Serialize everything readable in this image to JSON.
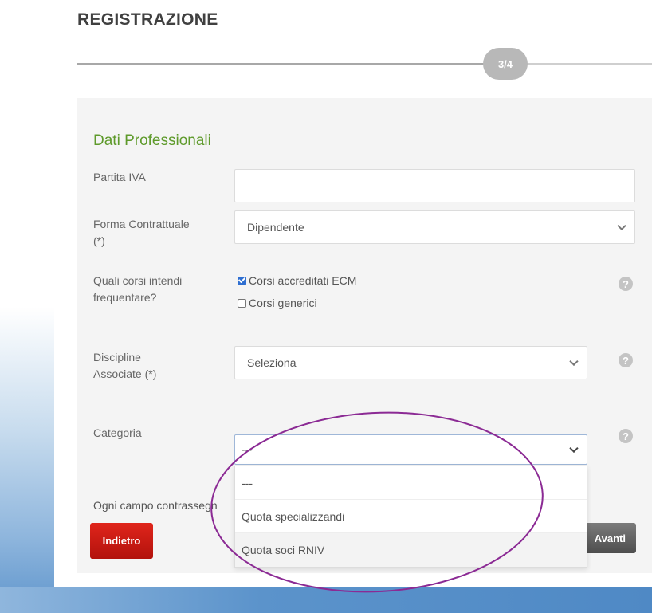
{
  "header": {
    "title": "REGISTRAZIONE",
    "step": "3/4",
    "step_progress": 0.75
  },
  "section": {
    "title": "Dati Professionali"
  },
  "fields": {
    "partita_iva": {
      "label": "Partita IVA",
      "value": ""
    },
    "forma_contrattuale": {
      "label_line1": "Forma Contrattuale",
      "label_line2": "(*)",
      "value": "Dipendente"
    },
    "corsi": {
      "label_line1": "Quali corsi intendi",
      "label_line2": "frequentare?",
      "options": [
        {
          "label": "Corsi accreditati ECM",
          "checked": true
        },
        {
          "label": "Corsi generici",
          "checked": false
        }
      ]
    },
    "discipline": {
      "label_line1": "Discipline",
      "label_line2": "Associate (*)",
      "value": "Seleziona"
    },
    "categoria": {
      "label": "Categoria",
      "value": "---",
      "options": [
        "---",
        "Quota specializzandi",
        "Quota soci RNIV"
      ]
    }
  },
  "footer": {
    "note": "Ogni campo contrassegn",
    "back_label": "Indietro",
    "next_label": "Avanti"
  },
  "colors": {
    "section_title": "#5e9a2b",
    "back_button": "#c8160f",
    "next_button": "#5a5a5a",
    "annotation": "#8b2a94",
    "checkbox": "#2f6fd1"
  }
}
